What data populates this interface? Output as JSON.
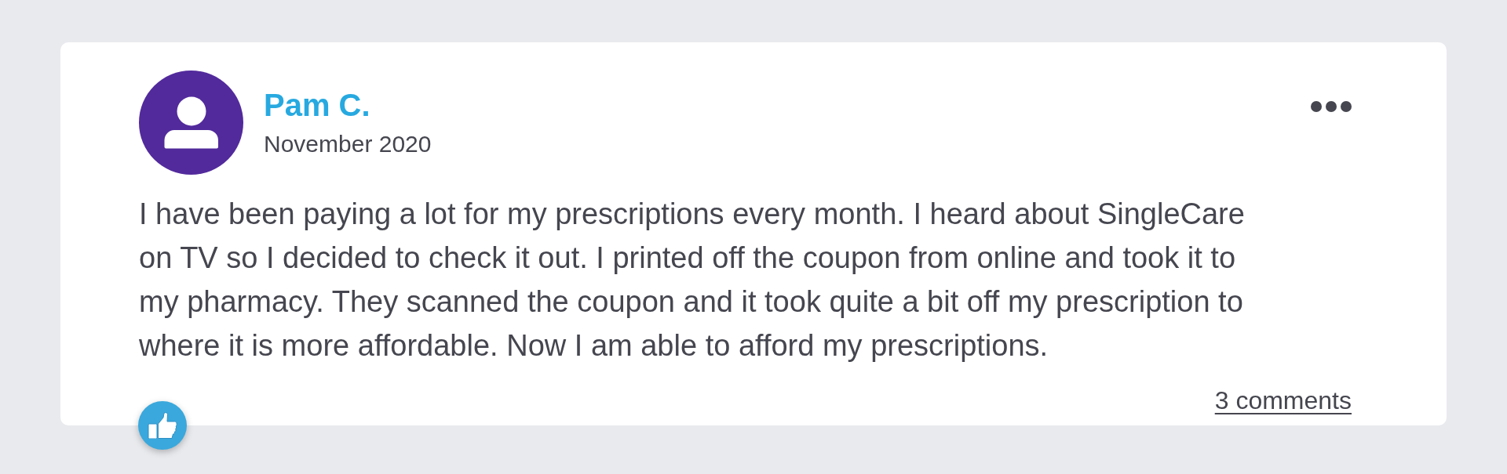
{
  "review": {
    "author": "Pam C.",
    "date": "November 2020",
    "text": "I have been paying a lot for my prescriptions every month. I heard about SingleCare on TV so I decided to check it out. I printed off the coupon from online and took it to my pharmacy. They scanned the coupon and it took quite a bit off my prescription to where it is more affordable. Now I am able to afford my prescriptions.",
    "comments_link": "3 comments"
  }
}
